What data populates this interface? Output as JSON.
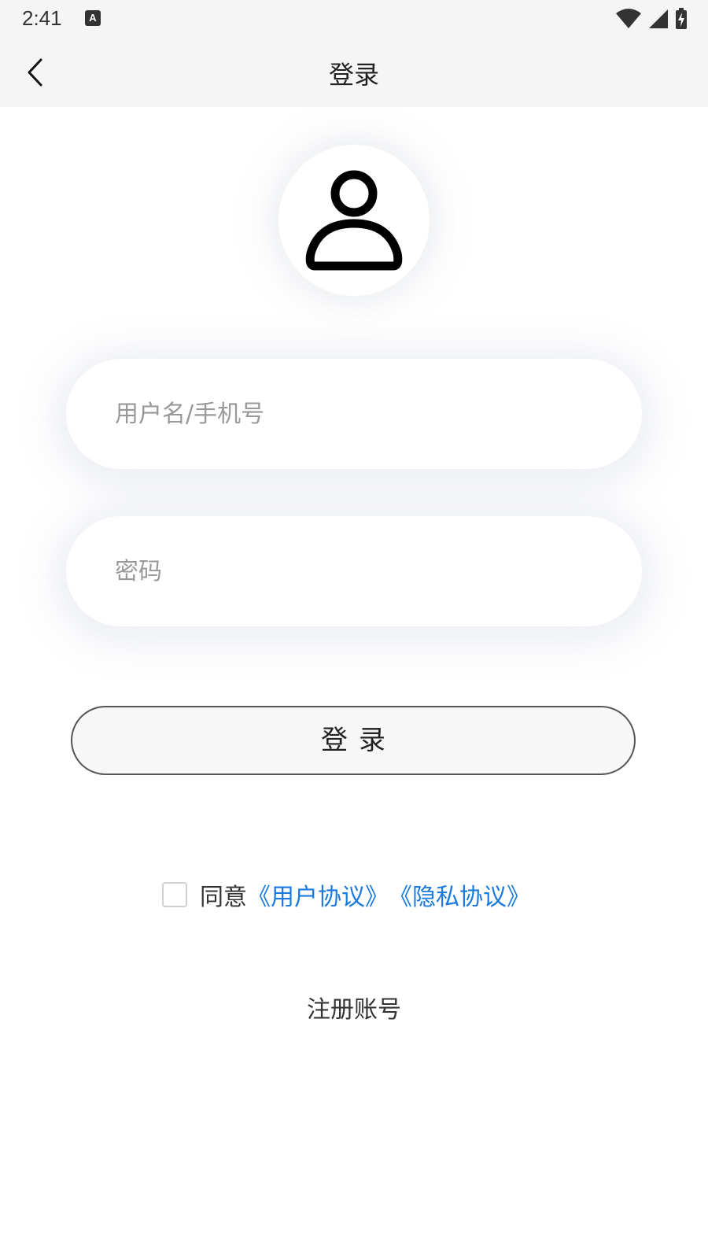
{
  "status_bar": {
    "time": "2:41",
    "notification_icon_letter": "A",
    "icons": [
      "wifi-icon",
      "signal-icon",
      "battery-charging-icon"
    ]
  },
  "nav": {
    "title": "登录",
    "back_icon": "chevron-left-icon"
  },
  "avatar": {
    "icon": "user-icon"
  },
  "form": {
    "username_placeholder": "用户名/手机号",
    "username_value": "",
    "password_placeholder": "密码",
    "password_value": ""
  },
  "login_button": {
    "label": "登录"
  },
  "agreement": {
    "checked": false,
    "prefix": "同意",
    "user_agreement": "《用户协议》",
    "privacy_agreement": "《隐私协议》"
  },
  "register": {
    "label": "注册账号"
  },
  "colors": {
    "link": "#1a7ae0",
    "bar_background": "#f5f5f5",
    "button_border": "#555555"
  }
}
